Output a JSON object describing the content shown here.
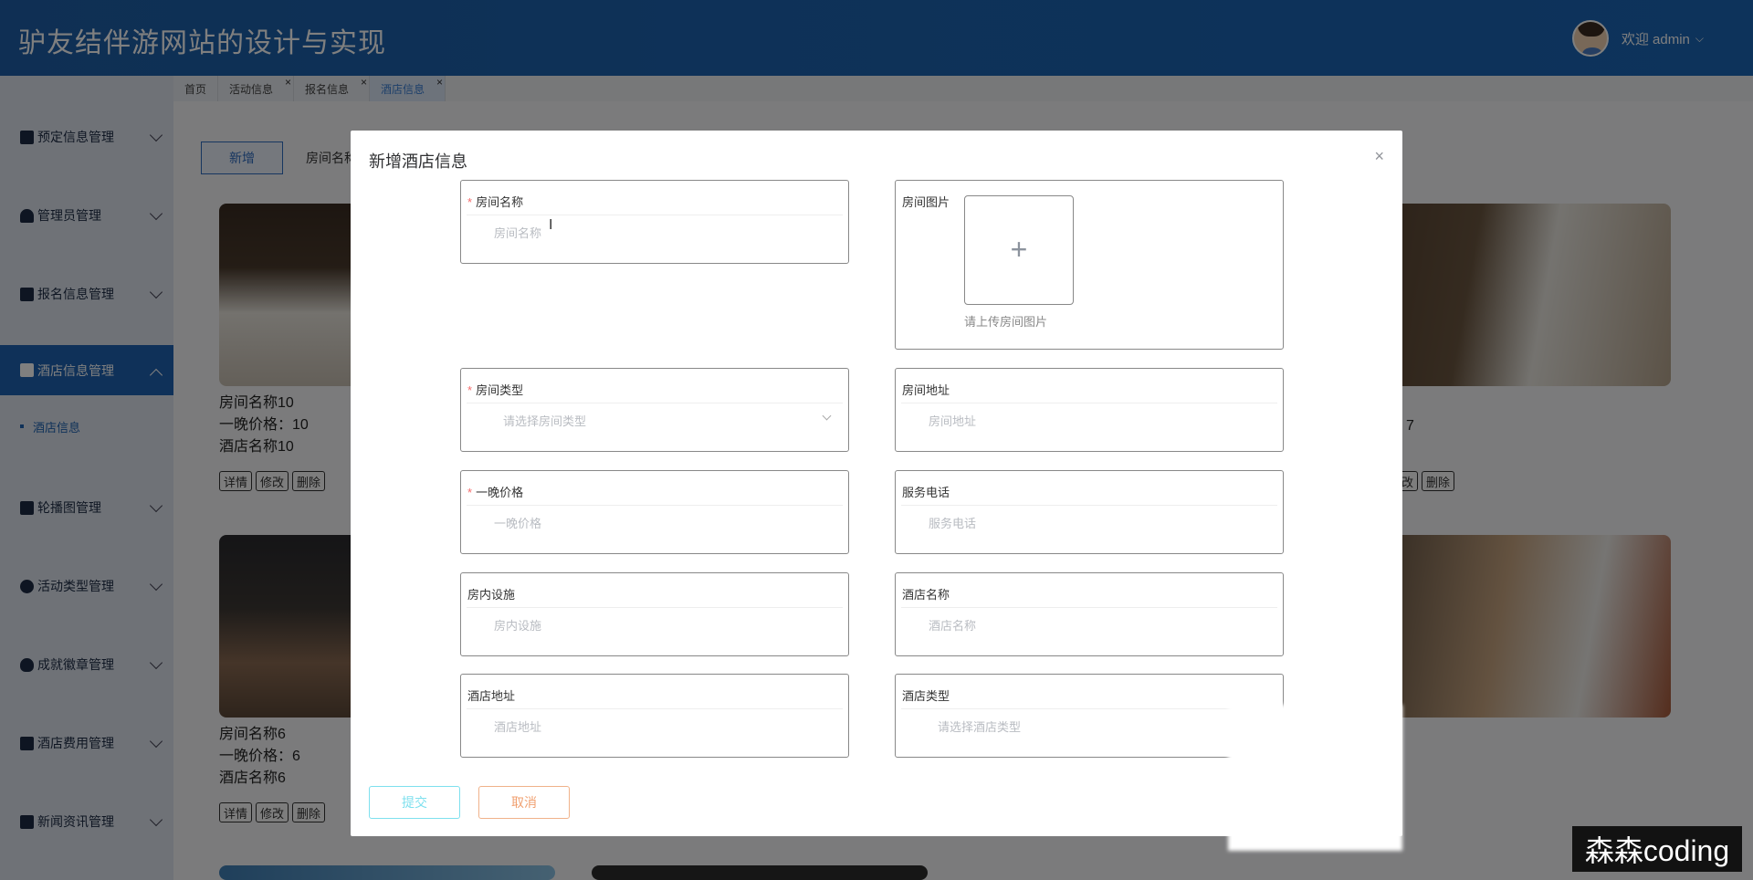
{
  "app": {
    "title": "驴友结伴游网站的设计与实现",
    "welcome": "欢迎 admin"
  },
  "sidebar": {
    "items": [
      {
        "label": "预定信息管理",
        "icon": "document-icon"
      },
      {
        "label": "管理员管理",
        "icon": "user-icon"
      },
      {
        "label": "报名信息管理",
        "icon": "form-icon"
      },
      {
        "label": "酒店信息管理",
        "icon": "grid-icon",
        "active": true
      },
      {
        "label": "轮播图管理",
        "icon": "grid-icon"
      },
      {
        "label": "活动类型管理",
        "icon": "circle-icon"
      },
      {
        "label": "成就徽章管理",
        "icon": "badge-icon"
      },
      {
        "label": "酒店费用管理",
        "icon": "grid-icon"
      },
      {
        "label": "新闻资讯管理",
        "icon": "mail-icon"
      }
    ],
    "sub_item": "酒店信息"
  },
  "tabs": [
    {
      "label": "首页",
      "closable": false
    },
    {
      "label": "活动信息",
      "closable": true
    },
    {
      "label": "报名信息",
      "closable": true
    },
    {
      "label": "酒店信息",
      "closable": true,
      "active": true
    }
  ],
  "page": {
    "add_button": "新增",
    "filter_label": "房间名称"
  },
  "cards": [
    {
      "room": "房间名称10",
      "price": "一晚价格：10",
      "hotel": "酒店名称10"
    },
    {
      "room": "房间名称6",
      "price": "一晚价格：6",
      "hotel": "酒店名称6"
    },
    {
      "price_partial": "7"
    }
  ],
  "card_buttons": {
    "detail": "详情",
    "edit": "修改",
    "delete": "删除"
  },
  "dialog": {
    "title": "新增酒店信息",
    "close": "×",
    "fields": {
      "room_name": {
        "label": "房间名称",
        "required": true,
        "placeholder": "房间名称"
      },
      "room_image": {
        "label": "房间图片",
        "tip": "请上传房间图片"
      },
      "room_type": {
        "label": "房间类型",
        "required": true,
        "placeholder": "请选择房间类型"
      },
      "room_address": {
        "label": "房间地址",
        "placeholder": "房间地址"
      },
      "price": {
        "label": "一晚价格",
        "required": true,
        "placeholder": "一晚价格"
      },
      "service_phone": {
        "label": "服务电话",
        "placeholder": "服务电话"
      },
      "facilities": {
        "label": "房内设施",
        "placeholder": "房内设施"
      },
      "hotel_name": {
        "label": "酒店名称",
        "placeholder": "酒店名称"
      },
      "hotel_address": {
        "label": "酒店地址",
        "placeholder": "酒店地址"
      },
      "hotel_type": {
        "label": "酒店类型",
        "placeholder": "请选择酒店类型"
      }
    },
    "submit": "提交",
    "cancel": "取消"
  },
  "watermark": "森森coding",
  "colors": {
    "primary": "#1f63b2",
    "required": "#f56c6c",
    "submit": "#7ee0ee",
    "cancel": "#f0a070"
  }
}
